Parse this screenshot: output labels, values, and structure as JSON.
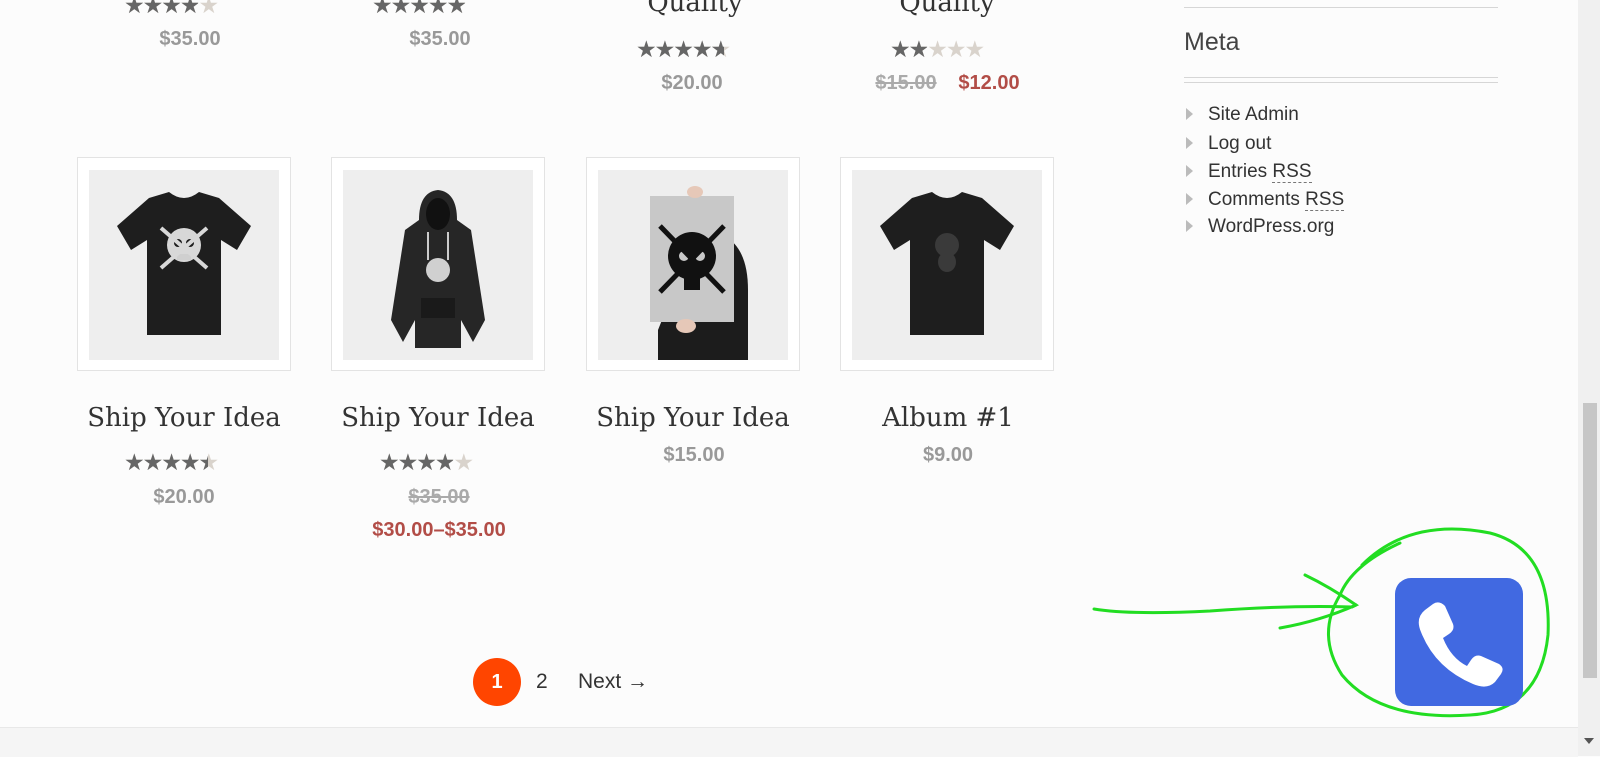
{
  "top_row": [
    {
      "rating": 4.0,
      "price": "$35.00"
    },
    {
      "rating": 5.0,
      "price": "$35.00"
    },
    {
      "title_fragment": "Quality",
      "rating": 4.75,
      "price": "$20.00"
    },
    {
      "title_fragment": "Quality",
      "rating": 2.0,
      "price_old": "$15.00",
      "price_new": "$12.00"
    }
  ],
  "products": [
    {
      "title": "Ship Your Idea",
      "rating": 4.5,
      "price": "$20.00",
      "image": "black-tshirt-skull"
    },
    {
      "title": "Ship Your Idea",
      "rating": 4.0,
      "price_old": "$35.00",
      "price_range": "$30.00–$35.00",
      "image": "black-hoodie-skull"
    },
    {
      "title": "Ship Your Idea",
      "price": "$15.00",
      "image": "poster-ship-your-idea"
    },
    {
      "title": "Album #1",
      "price": "$9.00",
      "image": "black-tshirt-album"
    }
  ],
  "meta": {
    "title": "Meta",
    "items": [
      {
        "label": "Site Admin"
      },
      {
        "label": "Log out"
      },
      {
        "label": "Entries",
        "abbr": "RSS"
      },
      {
        "label": "Comments",
        "abbr": "RSS"
      },
      {
        "label": "WordPress.org"
      }
    ]
  },
  "pagination": {
    "current": "1",
    "page2": "2",
    "next": "Next →"
  },
  "colors": {
    "accent": "#ff4500",
    "sale": "#b24d47",
    "phone_button": "#4169e1",
    "annotation": "#22dd22"
  },
  "icons": {
    "phone": "phone-icon"
  }
}
